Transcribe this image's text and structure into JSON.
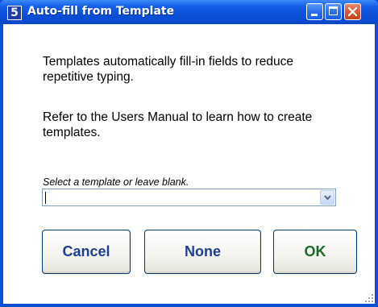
{
  "window": {
    "title": "Auto-fill from Template",
    "app_icon_glyph": "5"
  },
  "content": {
    "paragraph1": "Templates automatically fill-in fields to reduce repetitive typing.",
    "paragraph2": "Refer to the Users Manual to learn how to create templates.",
    "select_hint": "Select a template or leave blank.",
    "template_value": ""
  },
  "buttons": {
    "cancel": "Cancel",
    "none": "None",
    "ok": "OK"
  },
  "icons": {
    "app": "app-icon",
    "minimize": "minimize-icon",
    "maximize": "maximize-icon",
    "close": "close-icon",
    "dropdown": "chevron-down-icon",
    "resize": "resize-grip-icon"
  },
  "colors": {
    "title_bar": "#0a50d8",
    "link_text": "#1f3f91",
    "ok_text": "#1a6a2a"
  }
}
